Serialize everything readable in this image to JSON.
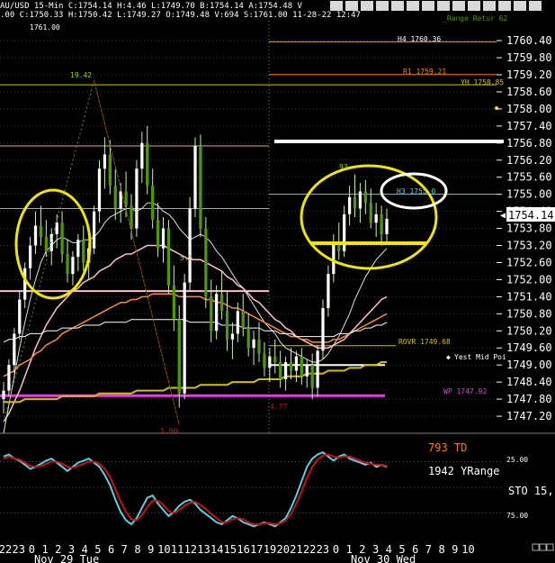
{
  "header": {
    "line1": "AU/USD 15-Min C:1754.14 H:4.46 L:1749.70 B:1754.14 A:1754.48 V",
    "line2": ".00 C:1750.33 H:1750.42 L:1749.27 O:1749.48 V:694 S:1761.00 11-28-22 12:47",
    "top_right": "_Range Retur 62"
  },
  "colors": {
    "background": "#000000",
    "up": "#ffffff",
    "down": "#4e9a06",
    "wick": "#c9f0b0",
    "gold": "#d4c000",
    "highlight": "#f0e600",
    "pivot_h": "#c8b400",
    "orange": "#ff7a00",
    "pink": "#ffc0cb",
    "magenta": "#e040e0",
    "stoch_k": "#5ad0e6",
    "stoch_d": "#cc1010"
  },
  "chart_data": [
    {
      "type": "line",
      "title": "",
      "xlabel": "",
      "ylabel": "",
      "ylim": [
        1746.6,
        1761.1
      ],
      "y_ticks": [
        "1760.40",
        "1759.80",
        "1759.20",
        "1758.60",
        "1758.00",
        "1757.40",
        "1756.80",
        "1756.20",
        "1755.60",
        "1755.00",
        "1754.40",
        "1753.80",
        "1753.20",
        "1752.60",
        "1752.00",
        "1751.40",
        "1750.80",
        "1750.20",
        "1749.60",
        "1749.00",
        "1748.40",
        "1747.80",
        "1747.20"
      ],
      "last_price_label": "1754.14",
      "x_ticks": [
        "22",
        "23",
        "0",
        "1",
        "2",
        "3",
        "4",
        "5",
        "6",
        "7",
        "8",
        "9",
        "10",
        "11",
        "12",
        "13",
        "14",
        "15",
        "16",
        "17",
        "19",
        "20",
        "21",
        "22",
        "23",
        "0",
        "1",
        "2",
        "3",
        "4",
        "5",
        "6",
        "7",
        "8",
        "9",
        "10"
      ],
      "date_labels": [
        "Nov 29 Tue",
        "Nov 30 Wed"
      ],
      "level_labels": {
        "s": "1761.00",
        "h4": "H4 1760.36",
        "r1": "R1 1759.21",
        "yh": "YH 1758.85",
        "h3": "H3 1755.0",
        "rovr": "ROVR 1749.68",
        "yest_mid": "Yest Mid Poi",
        "wp": "WP 1747.92",
        "swing_high": "19.42",
        "swing_low": "4.77",
        "low_mark": "1.90",
        "green_mark": "93",
        "mid_mark": "5.5"
      },
      "levels": [
        {
          "name": "H4",
          "value": 1760.36
        },
        {
          "name": "R1",
          "value": 1759.21
        },
        {
          "name": "YH",
          "value": 1758.85
        },
        {
          "name": "H3",
          "value": 1755.0
        },
        {
          "name": "ROVR",
          "value": 1749.68
        },
        {
          "name": "WP",
          "value": 1747.92
        }
      ],
      "candles": [
        [
          1747.8,
          1748.4,
          1747.3,
          1748.1
        ],
        [
          1748.1,
          1749.2,
          1747.9,
          1749.0
        ],
        [
          1749.0,
          1750.3,
          1748.7,
          1750.1
        ],
        [
          1750.1,
          1751.6,
          1749.9,
          1751.3
        ],
        [
          1751.3,
          1752.6,
          1751.0,
          1752.4
        ],
        [
          1752.4,
          1753.5,
          1752.0,
          1753.2
        ],
        [
          1753.2,
          1754.4,
          1752.9,
          1753.9
        ],
        [
          1753.9,
          1754.6,
          1753.2,
          1753.5
        ],
        [
          1753.5,
          1754.1,
          1752.8,
          1753.0
        ],
        [
          1753.0,
          1753.8,
          1752.5,
          1753.6
        ],
        [
          1753.6,
          1754.3,
          1753.1,
          1754.0
        ],
        [
          1754.0,
          1754.4,
          1752.6,
          1752.9
        ],
        [
          1752.9,
          1753.4,
          1751.9,
          1752.2
        ],
        [
          1752.2,
          1753.0,
          1751.8,
          1752.8
        ],
        [
          1752.8,
          1753.6,
          1752.3,
          1753.4
        ],
        [
          1753.4,
          1753.9,
          1752.3,
          1752.6
        ],
        [
          1752.6,
          1753.3,
          1752.0,
          1753.1
        ],
        [
          1753.1,
          1754.6,
          1752.9,
          1754.4
        ],
        [
          1754.4,
          1756.2,
          1754.0,
          1755.9
        ],
        [
          1755.9,
          1757.0,
          1755.2,
          1756.4
        ],
        [
          1756.4,
          1756.9,
          1755.0,
          1755.3
        ],
        [
          1755.3,
          1755.9,
          1754.1,
          1754.5
        ],
        [
          1754.5,
          1755.4,
          1754.0,
          1755.1
        ],
        [
          1755.1,
          1755.8,
          1754.2,
          1754.6
        ],
        [
          1754.6,
          1755.0,
          1753.4,
          1753.8
        ],
        [
          1753.8,
          1756.2,
          1753.5,
          1755.9
        ],
        [
          1755.9,
          1757.2,
          1755.4,
          1756.8
        ],
        [
          1756.8,
          1757.4,
          1755.0,
          1755.3
        ],
        [
          1755.3,
          1755.9,
          1753.8,
          1754.1
        ],
        [
          1754.1,
          1754.7,
          1752.8,
          1753.1
        ],
        [
          1753.1,
          1754.2,
          1752.6,
          1753.8
        ],
        [
          1753.8,
          1754.1,
          1751.5,
          1751.8
        ],
        [
          1751.8,
          1752.5,
          1750.2,
          1750.6
        ],
        [
          1750.6,
          1751.1,
          1747.5,
          1748.0
        ],
        [
          1748.0,
          1752.2,
          1747.8,
          1751.9
        ],
        [
          1751.9,
          1754.9,
          1751.6,
          1754.5
        ],
        [
          1754.5,
          1757.0,
          1754.2,
          1756.7
        ],
        [
          1756.7,
          1757.1,
          1753.5,
          1753.8
        ],
        [
          1753.8,
          1754.2,
          1751.0,
          1751.4
        ],
        [
          1751.4,
          1752.0,
          1749.8,
          1750.2
        ],
        [
          1750.2,
          1751.8,
          1749.9,
          1751.5
        ],
        [
          1751.5,
          1752.3,
          1750.6,
          1750.9
        ],
        [
          1750.9,
          1751.6,
          1749.5,
          1749.9
        ],
        [
          1749.9,
          1750.5,
          1749.2,
          1750.1
        ],
        [
          1750.1,
          1751.2,
          1749.8,
          1750.9
        ],
        [
          1750.9,
          1751.5,
          1750.0,
          1750.3
        ],
        [
          1750.3,
          1750.8,
          1749.3,
          1749.6
        ],
        [
          1749.6,
          1750.2,
          1749.0,
          1749.9
        ],
        [
          1749.9,
          1750.5,
          1749.1,
          1749.4
        ],
        [
          1749.4,
          1749.8,
          1748.6,
          1748.9
        ],
        [
          1748.9,
          1749.6,
          1748.4,
          1749.3
        ],
        [
          1749.3,
          1749.9,
          1748.7,
          1749.1
        ],
        [
          1749.1,
          1749.5,
          1748.2,
          1748.5
        ],
        [
          1748.5,
          1749.3,
          1748.1,
          1749.1
        ],
        [
          1749.1,
          1749.6,
          1748.5,
          1748.8
        ],
        [
          1748.8,
          1749.5,
          1748.4,
          1749.3
        ],
        [
          1749.3,
          1749.6,
          1748.3,
          1748.6
        ],
        [
          1748.6,
          1749.2,
          1748.2,
          1749.0
        ],
        [
          1749.0,
          1749.4,
          1747.8,
          1748.2
        ],
        [
          1748.2,
          1749.7,
          1747.9,
          1749.5
        ],
        [
          1749.5,
          1751.3,
          1749.2,
          1751.0
        ],
        [
          1751.0,
          1752.5,
          1750.7,
          1752.2
        ],
        [
          1752.2,
          1753.6,
          1751.9,
          1753.3
        ],
        [
          1753.3,
          1754.0,
          1752.7,
          1753.0
        ],
        [
          1753.0,
          1754.6,
          1752.8,
          1754.3
        ],
        [
          1754.3,
          1755.3,
          1753.9,
          1754.9
        ],
        [
          1754.9,
          1755.7,
          1754.2,
          1754.5
        ],
        [
          1754.5,
          1755.4,
          1754.0,
          1755.1
        ],
        [
          1755.1,
          1755.5,
          1754.3,
          1754.7
        ],
        [
          1754.7,
          1755.2,
          1753.8,
          1754.0
        ],
        [
          1754.0,
          1754.7,
          1753.5,
          1754.3
        ],
        [
          1754.3,
          1754.6,
          1753.2,
          1753.6
        ],
        [
          1753.6,
          1754.5,
          1753.3,
          1754.14
        ]
      ],
      "series": [
        {
          "values": [
            1746.6,
            1747.6,
            1748.6,
            1749.6,
            1750.5,
            1751.3,
            1752.0,
            1752.6,
            1753.0,
            1753.2,
            1753.4,
            1753.5,
            1753.4,
            1753.3,
            1753.3,
            1753.4,
            1753.4,
            1753.5,
            1753.7,
            1754.0,
            1754.2,
            1754.3,
            1754.4,
            1754.5,
            1754.5,
            1754.4,
            1754.5,
            1754.7,
            1754.7,
            1754.6,
            1754.4,
            1754.3,
            1754.1,
            1753.8,
            1753.6,
            1753.4,
            1753.5,
            1753.6,
            1753.5,
            1753.3,
            1753.0,
            1752.8,
            1752.5,
            1752.2,
            1751.9,
            1751.7,
            1751.4,
            1751.1,
            1750.8,
            1750.5,
            1750.3,
            1750.1,
            1749.8,
            1749.6,
            1749.5,
            1749.4,
            1749.3,
            1749.2,
            1749.1,
            1749.1,
            1749.2,
            1749.4,
            1749.7,
            1750.0,
            1750.4,
            1750.8,
            1751.3,
            1751.7,
            1752.1,
            1752.4,
            1752.7,
            1752.9,
            1753.1
          ]
        },
        {
          "values": [
            1747.0,
            1747.3,
            1747.7,
            1748.1,
            1748.6,
            1749.1,
            1749.6,
            1750.0,
            1750.4,
            1750.7,
            1751.0,
            1751.2,
            1751.4,
            1751.6,
            1751.7,
            1751.9,
            1752.0,
            1752.1,
            1752.3,
            1752.4,
            1752.5,
            1752.7,
            1752.8,
            1752.9,
            1752.9,
            1753.0,
            1753.1,
            1753.2,
            1753.2,
            1753.2,
            1753.2,
            1753.1,
            1753.0,
            1752.9,
            1752.8,
            1752.7,
            1752.7,
            1752.7,
            1752.6,
            1752.5,
            1752.4,
            1752.3,
            1752.1,
            1752.0,
            1751.8,
            1751.7,
            1751.5,
            1751.3,
            1751.2,
            1751.0,
            1750.8,
            1750.6,
            1750.5,
            1750.3,
            1750.2,
            1750.0,
            1749.9,
            1749.8,
            1749.7,
            1749.6,
            1749.6,
            1749.6,
            1749.7,
            1749.8,
            1749.9,
            1750.1,
            1750.3,
            1750.5,
            1750.7,
            1750.9,
            1751.1,
            1751.3,
            1751.4
          ]
        },
        {
          "values": [
            1748.6,
            1748.7,
            1748.8,
            1749.0,
            1749.1,
            1749.2,
            1749.4,
            1749.5,
            1749.7,
            1749.8,
            1749.9,
            1750.1,
            1750.2,
            1750.3,
            1750.4,
            1750.5,
            1750.6,
            1750.7,
            1750.8,
            1750.9,
            1751.0,
            1751.1,
            1751.2,
            1751.2,
            1751.3,
            1751.3,
            1751.4,
            1751.4,
            1751.5,
            1751.5,
            1751.5,
            1751.5,
            1751.5,
            1751.4,
            1751.4,
            1751.4,
            1751.4,
            1751.4,
            1751.3,
            1751.3,
            1751.2,
            1751.2,
            1751.1,
            1751.0,
            1751.0,
            1750.9,
            1750.8,
            1750.7,
            1750.6,
            1750.5,
            1750.4,
            1750.3,
            1750.2,
            1750.1,
            1750.0,
            1750.0,
            1749.9,
            1749.9,
            1749.8,
            1749.8,
            1749.8,
            1749.8,
            1749.9,
            1749.9,
            1750.0,
            1750.1,
            1750.2,
            1750.3,
            1750.4,
            1750.5,
            1750.6,
            1750.7,
            1750.8
          ]
        },
        {
          "values": [
            1749.8,
            1749.9,
            1749.9,
            1750.0,
            1750.0,
            1750.1,
            1750.1,
            1750.1,
            1750.2,
            1750.2,
            1750.2,
            1750.3,
            1750.3,
            1750.3,
            1750.3,
            1750.4,
            1750.4,
            1750.4,
            1750.4,
            1750.5,
            1750.5,
            1750.5,
            1750.5,
            1750.5,
            1750.6,
            1750.6,
            1750.6,
            1750.6,
            1750.6,
            1750.6,
            1750.6,
            1750.6,
            1750.6,
            1750.6,
            1750.6,
            1750.5,
            1750.5,
            1750.5,
            1750.5,
            1750.5,
            1750.5,
            1750.4,
            1750.4,
            1750.4,
            1750.4,
            1750.3,
            1750.3,
            1750.3,
            1750.3,
            1750.2,
            1750.2,
            1750.2,
            1750.1,
            1750.1,
            1750.1,
            1750.0,
            1750.0,
            1750.0,
            1750.0,
            1750.0,
            1750.0,
            1750.0,
            1750.0,
            1750.1,
            1750.1,
            1750.1,
            1750.2,
            1750.2,
            1750.3,
            1750.3,
            1750.4,
            1750.4,
            1750.5
          ]
        },
        {
          "values": [
            1747.7,
            1747.7,
            1747.7,
            1747.7,
            1747.8,
            1747.8,
            1747.8,
            1747.8,
            1747.8,
            1747.8,
            1747.8,
            1747.9,
            1747.9,
            1747.9,
            1747.9,
            1747.9,
            1747.9,
            1747.9,
            1748.0,
            1748.0,
            1748.0,
            1748.0,
            1748.0,
            1748.0,
            1748.0,
            1748.1,
            1748.1,
            1748.1,
            1748.1,
            1748.1,
            1748.1,
            1748.2,
            1748.2,
            1748.2,
            1748.2,
            1748.2,
            1748.2,
            1748.3,
            1748.3,
            1748.3,
            1748.3,
            1748.3,
            1748.3,
            1748.4,
            1748.4,
            1748.4,
            1748.4,
            1748.4,
            1748.5,
            1748.5,
            1748.5,
            1748.5,
            1748.5,
            1748.6,
            1748.6,
            1748.6,
            1748.6,
            1748.7,
            1748.7,
            1748.7,
            1748.7,
            1748.8,
            1748.8,
            1748.8,
            1748.8,
            1748.9,
            1748.9,
            1748.9,
            1749.0,
            1749.0,
            1749.0,
            1749.1,
            1749.1
          ]
        }
      ]
    },
    {
      "type": "line",
      "title": "",
      "ylim": [
        0,
        100
      ],
      "y_ticks": [
        "25.00",
        "75.00"
      ],
      "label_td": "793 TD",
      "label_yrange": "1942 YRange",
      "label_sto": "STO  15,",
      "series": [
        {
          "values": [
            20,
            18,
            22,
            24,
            28,
            32,
            30,
            27,
            24,
            22,
            26,
            30,
            34,
            30,
            26,
            24,
            22,
            26,
            30,
            38,
            48,
            62,
            74,
            82,
            86,
            80,
            70,
            60,
            58,
            66,
            72,
            78,
            74,
            68,
            64,
            62,
            66,
            72,
            76,
            80,
            84,
            86,
            82,
            78,
            80,
            84,
            86,
            88,
            86,
            84,
            86,
            88,
            84,
            80,
            70,
            58,
            44,
            30,
            22,
            18,
            16,
            20,
            24,
            20,
            18,
            22,
            24,
            26,
            28,
            26,
            30,
            28,
            30
          ]
        },
        {
          "values": [
            22,
            20,
            22,
            23,
            26,
            29,
            30,
            29,
            27,
            25,
            25,
            27,
            30,
            31,
            29,
            27,
            25,
            25,
            27,
            32,
            40,
            52,
            64,
            74,
            81,
            82,
            77,
            69,
            63,
            63,
            67,
            73,
            75,
            72,
            68,
            65,
            64,
            67,
            71,
            76,
            80,
            84,
            84,
            81,
            80,
            81,
            84,
            86,
            86,
            85,
            85,
            86,
            85,
            82,
            76,
            66,
            54,
            41,
            30,
            23,
            19,
            18,
            20,
            21,
            20,
            20,
            22,
            24,
            26,
            27,
            28,
            28,
            29
          ]
        }
      ]
    }
  ]
}
